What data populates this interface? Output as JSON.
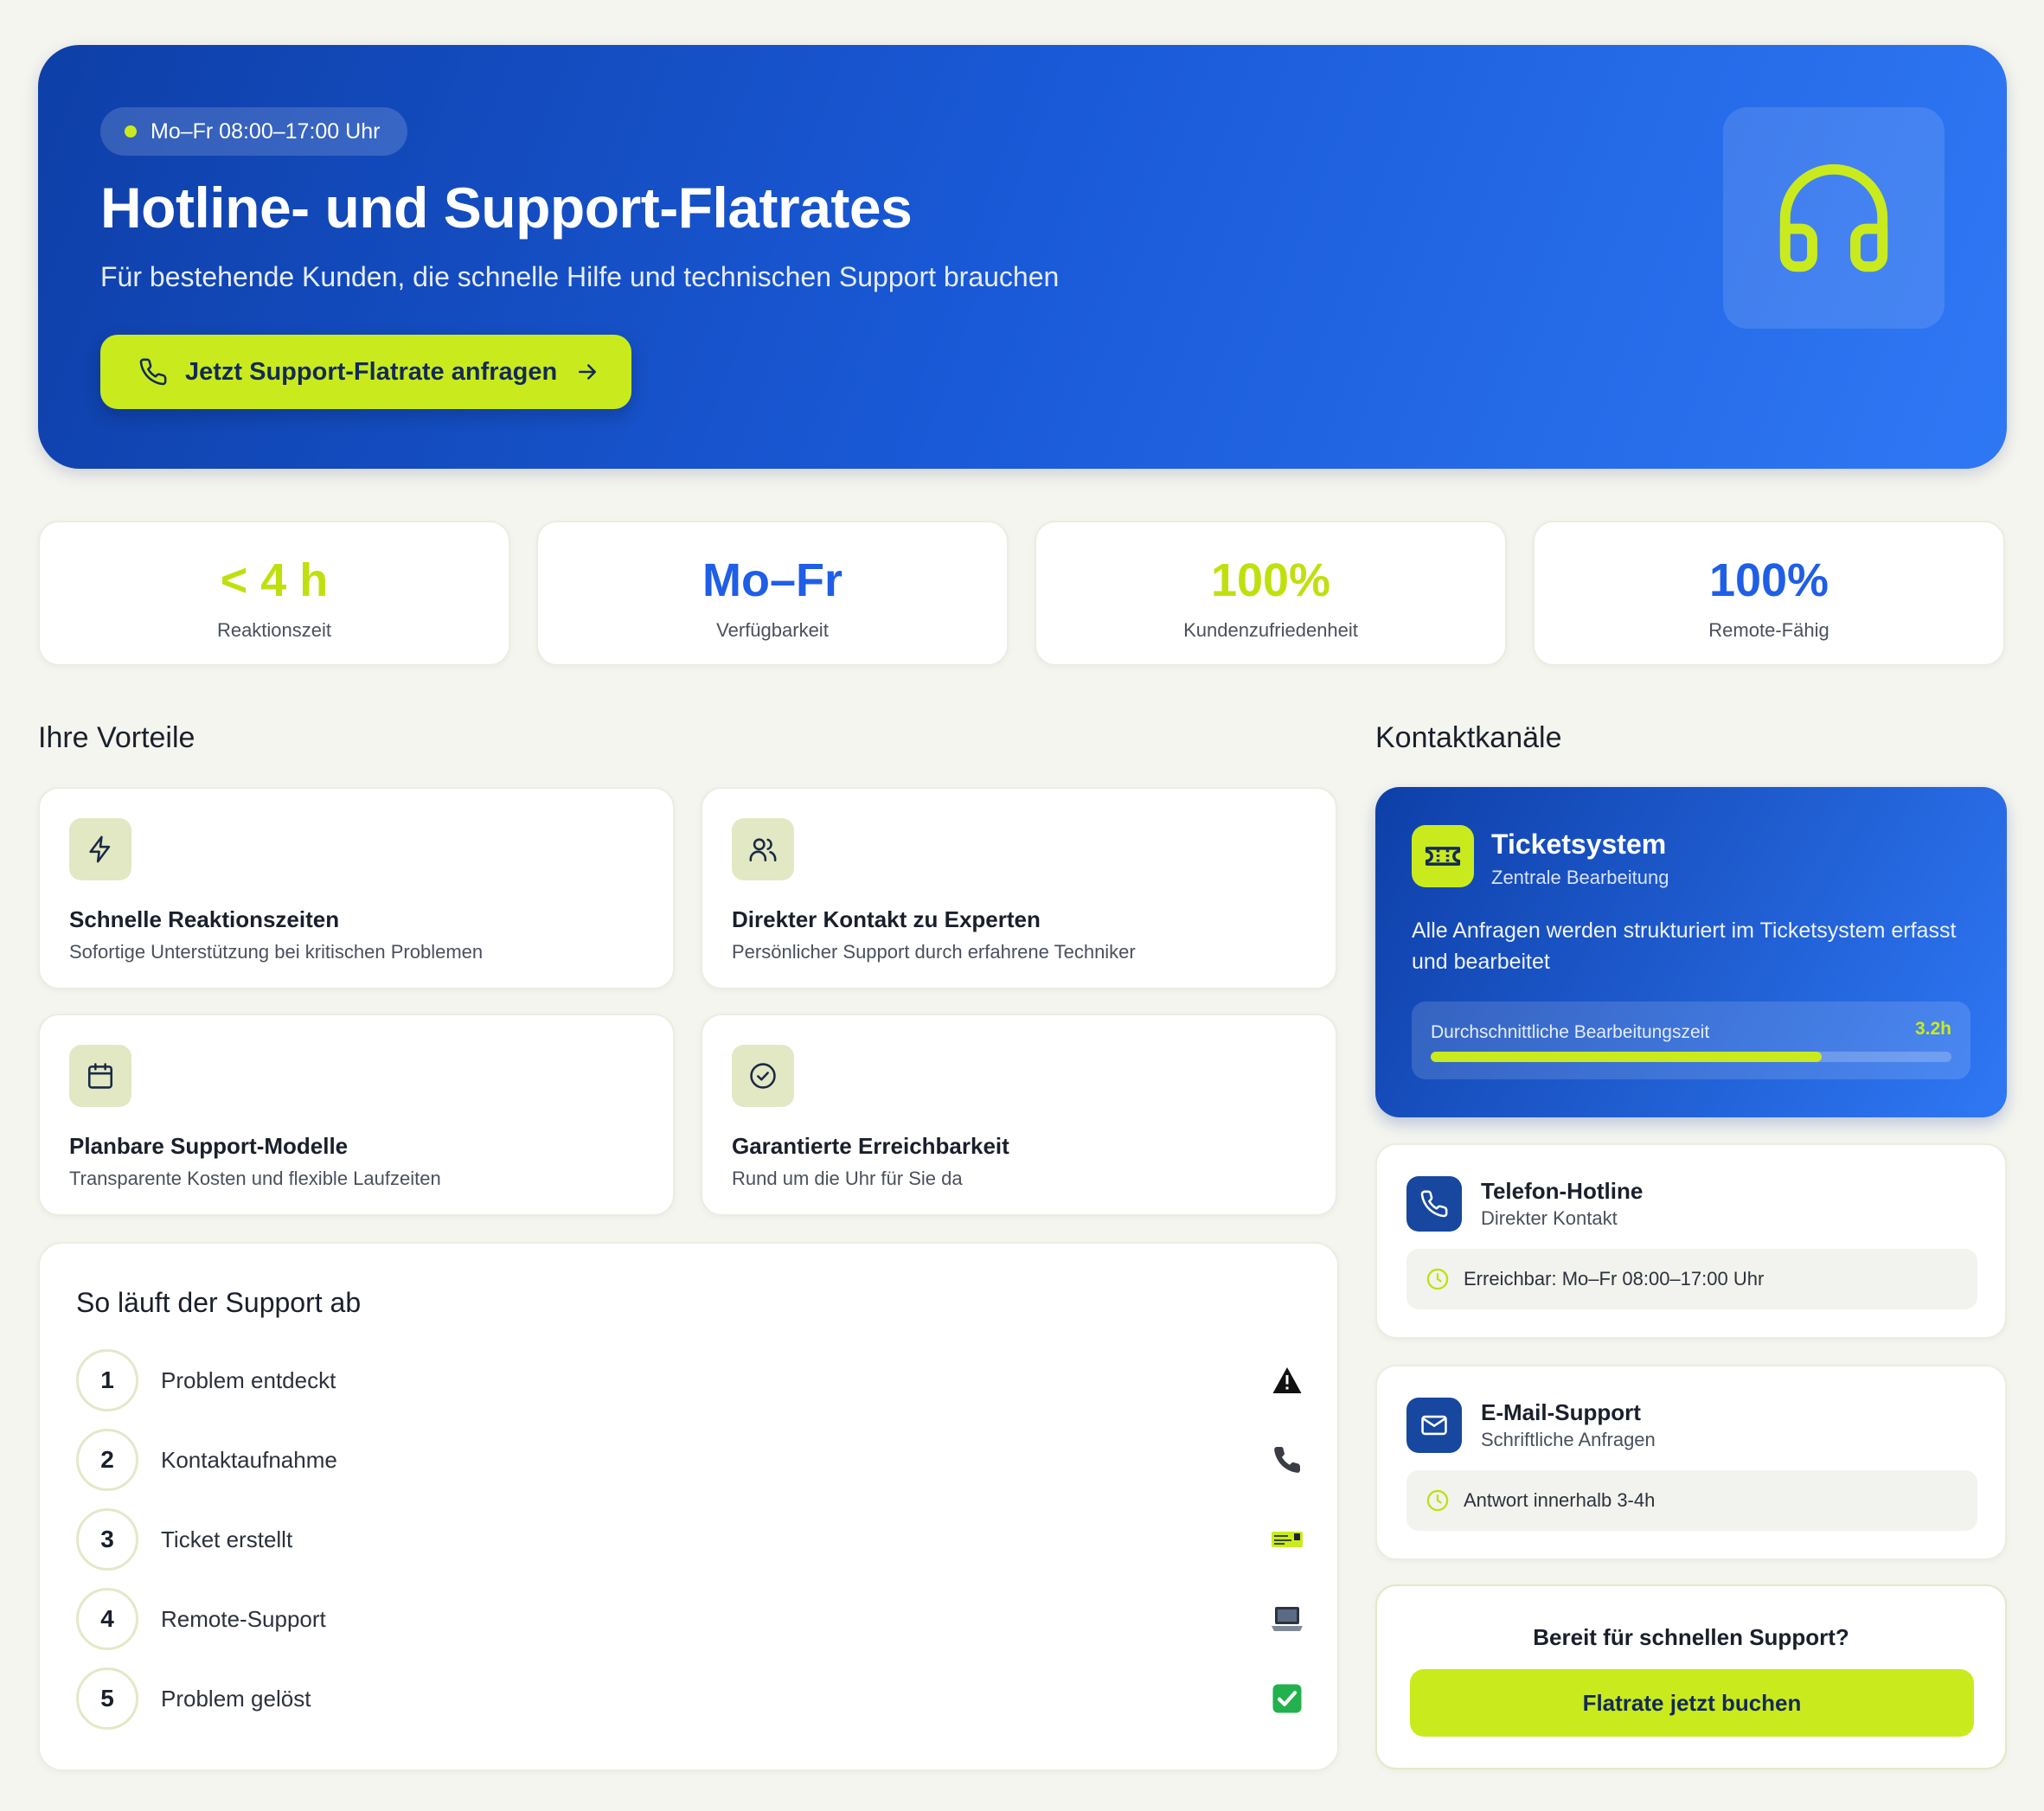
{
  "hero": {
    "hours_badge": "Mo–Fr 08:00–17:00 Uhr",
    "title": "Hotline- und Support-Flatrates",
    "subtitle": "Für bestehende Kunden, die schnelle Hilfe und technischen Support brauchen",
    "cta_label": "Jetzt Support-Flatrate anfragen",
    "icon": "headset-icon"
  },
  "stats": [
    {
      "value": "< 4 h",
      "label": "Reaktionszeit",
      "color": "#c0e00e"
    },
    {
      "value": "Mo–Fr",
      "label": "Verfügbarkeit",
      "color": "#1f5ee6"
    },
    {
      "value": "100%",
      "label": "Kundenzufriedenheit",
      "color": "#c0e00e"
    },
    {
      "value": "100%",
      "label": "Remote-Fähig",
      "color": "#1f5ee6"
    }
  ],
  "benefits": {
    "title": "Ihre Vorteile",
    "items": [
      {
        "title": "Schnelle Reaktionszeiten",
        "desc": "Sofortige Unterstützung bei kritischen Problemen",
        "icon": "lightning-icon"
      },
      {
        "title": "Direkter Kontakt zu Experten",
        "desc": "Persönlicher Support durch erfahrene Techniker",
        "icon": "users-icon"
      },
      {
        "title": "Planbare Support-Modelle",
        "desc": "Transparente Kosten und flexible Laufzeiten",
        "icon": "calendar-icon"
      },
      {
        "title": "Garantierte Erreichbarkeit",
        "desc": "Rund um die Uhr für Sie da",
        "icon": "check-circle-icon"
      }
    ]
  },
  "process": {
    "title": "So läuft der Support ab",
    "steps": [
      {
        "num": "1",
        "label": "Problem entdeckt",
        "icon": "warning-icon"
      },
      {
        "num": "2",
        "label": "Kontaktaufnahme",
        "icon": "phone-icon"
      },
      {
        "num": "3",
        "label": "Ticket erstellt",
        "icon": "ticket-card-icon"
      },
      {
        "num": "4",
        "label": "Remote-Support",
        "icon": "laptop-icon"
      },
      {
        "num": "5",
        "label": "Problem gelöst",
        "icon": "checkbox-icon"
      }
    ]
  },
  "channels": {
    "title": "Kontaktkanäle",
    "ticket": {
      "title": "Ticketsystem",
      "subtitle": "Zentrale Bearbeitung",
      "desc": "Alle Anfragen werden strukturiert im Ticketsystem erfasst und bearbeitet",
      "metric_label": "Durchschnittliche Bearbeitungszeit",
      "metric_value": "3.2h",
      "metric_fill_fraction": 0.75
    },
    "phone": {
      "title": "Telefon-Hotline",
      "subtitle": "Direkter Kontakt",
      "info": "Erreichbar: Mo–Fr 08:00–17:00 Uhr"
    },
    "email": {
      "title": "E-Mail-Support",
      "subtitle": "Schriftliche Anfragen",
      "info": "Antwort innerhalb 3-4h"
    }
  },
  "cta": {
    "title": "Bereit für schnellen Support?",
    "button": "Flatrate jetzt buchen"
  },
  "colors": {
    "accent_lime": "#c9eb1e",
    "brand_blue": "#1f5ee6",
    "brand_blue_dark": "#0e3fa8"
  }
}
